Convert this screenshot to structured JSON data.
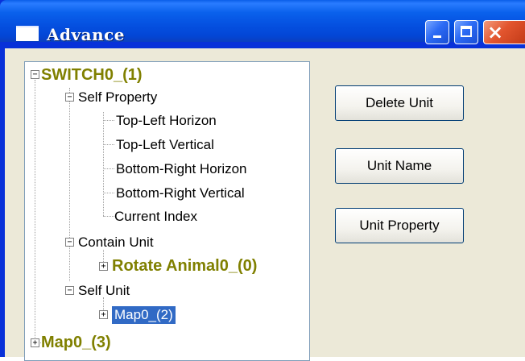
{
  "window": {
    "title": "Advance",
    "controls": {
      "minimize": "minimize",
      "maximize": "maximize",
      "close": "×"
    }
  },
  "tree": {
    "root": {
      "label": "SWITCH0_(1)",
      "toggle": "−"
    },
    "self_property": {
      "label": "Self Property",
      "toggle": "−"
    },
    "props": [
      "Top-Left Horizon",
      "Top-Left Vertical",
      "Bottom-Right Horizon",
      "Bottom-Right Vertical",
      "Current Index"
    ],
    "contain_unit": {
      "label": "Contain Unit",
      "toggle": "−"
    },
    "rotate_animal": {
      "label": "Rotate Animal0_(0)",
      "toggle": "+"
    },
    "self_unit": {
      "label": "Self Unit",
      "toggle": "−"
    },
    "map_child": {
      "label": "Map0_(2)",
      "toggle": "+"
    },
    "map_root": {
      "label": "Map0_(3)",
      "toggle": "+"
    }
  },
  "buttons": {
    "delete_unit": "Delete Unit",
    "unit_name": "Unit Name",
    "unit_property": "Unit Property"
  },
  "colors": {
    "title_blue": "#0550e0",
    "unit_label_olive": "#808000",
    "selection_blue": "#316ac5",
    "client_beige": "#ece9d8"
  }
}
